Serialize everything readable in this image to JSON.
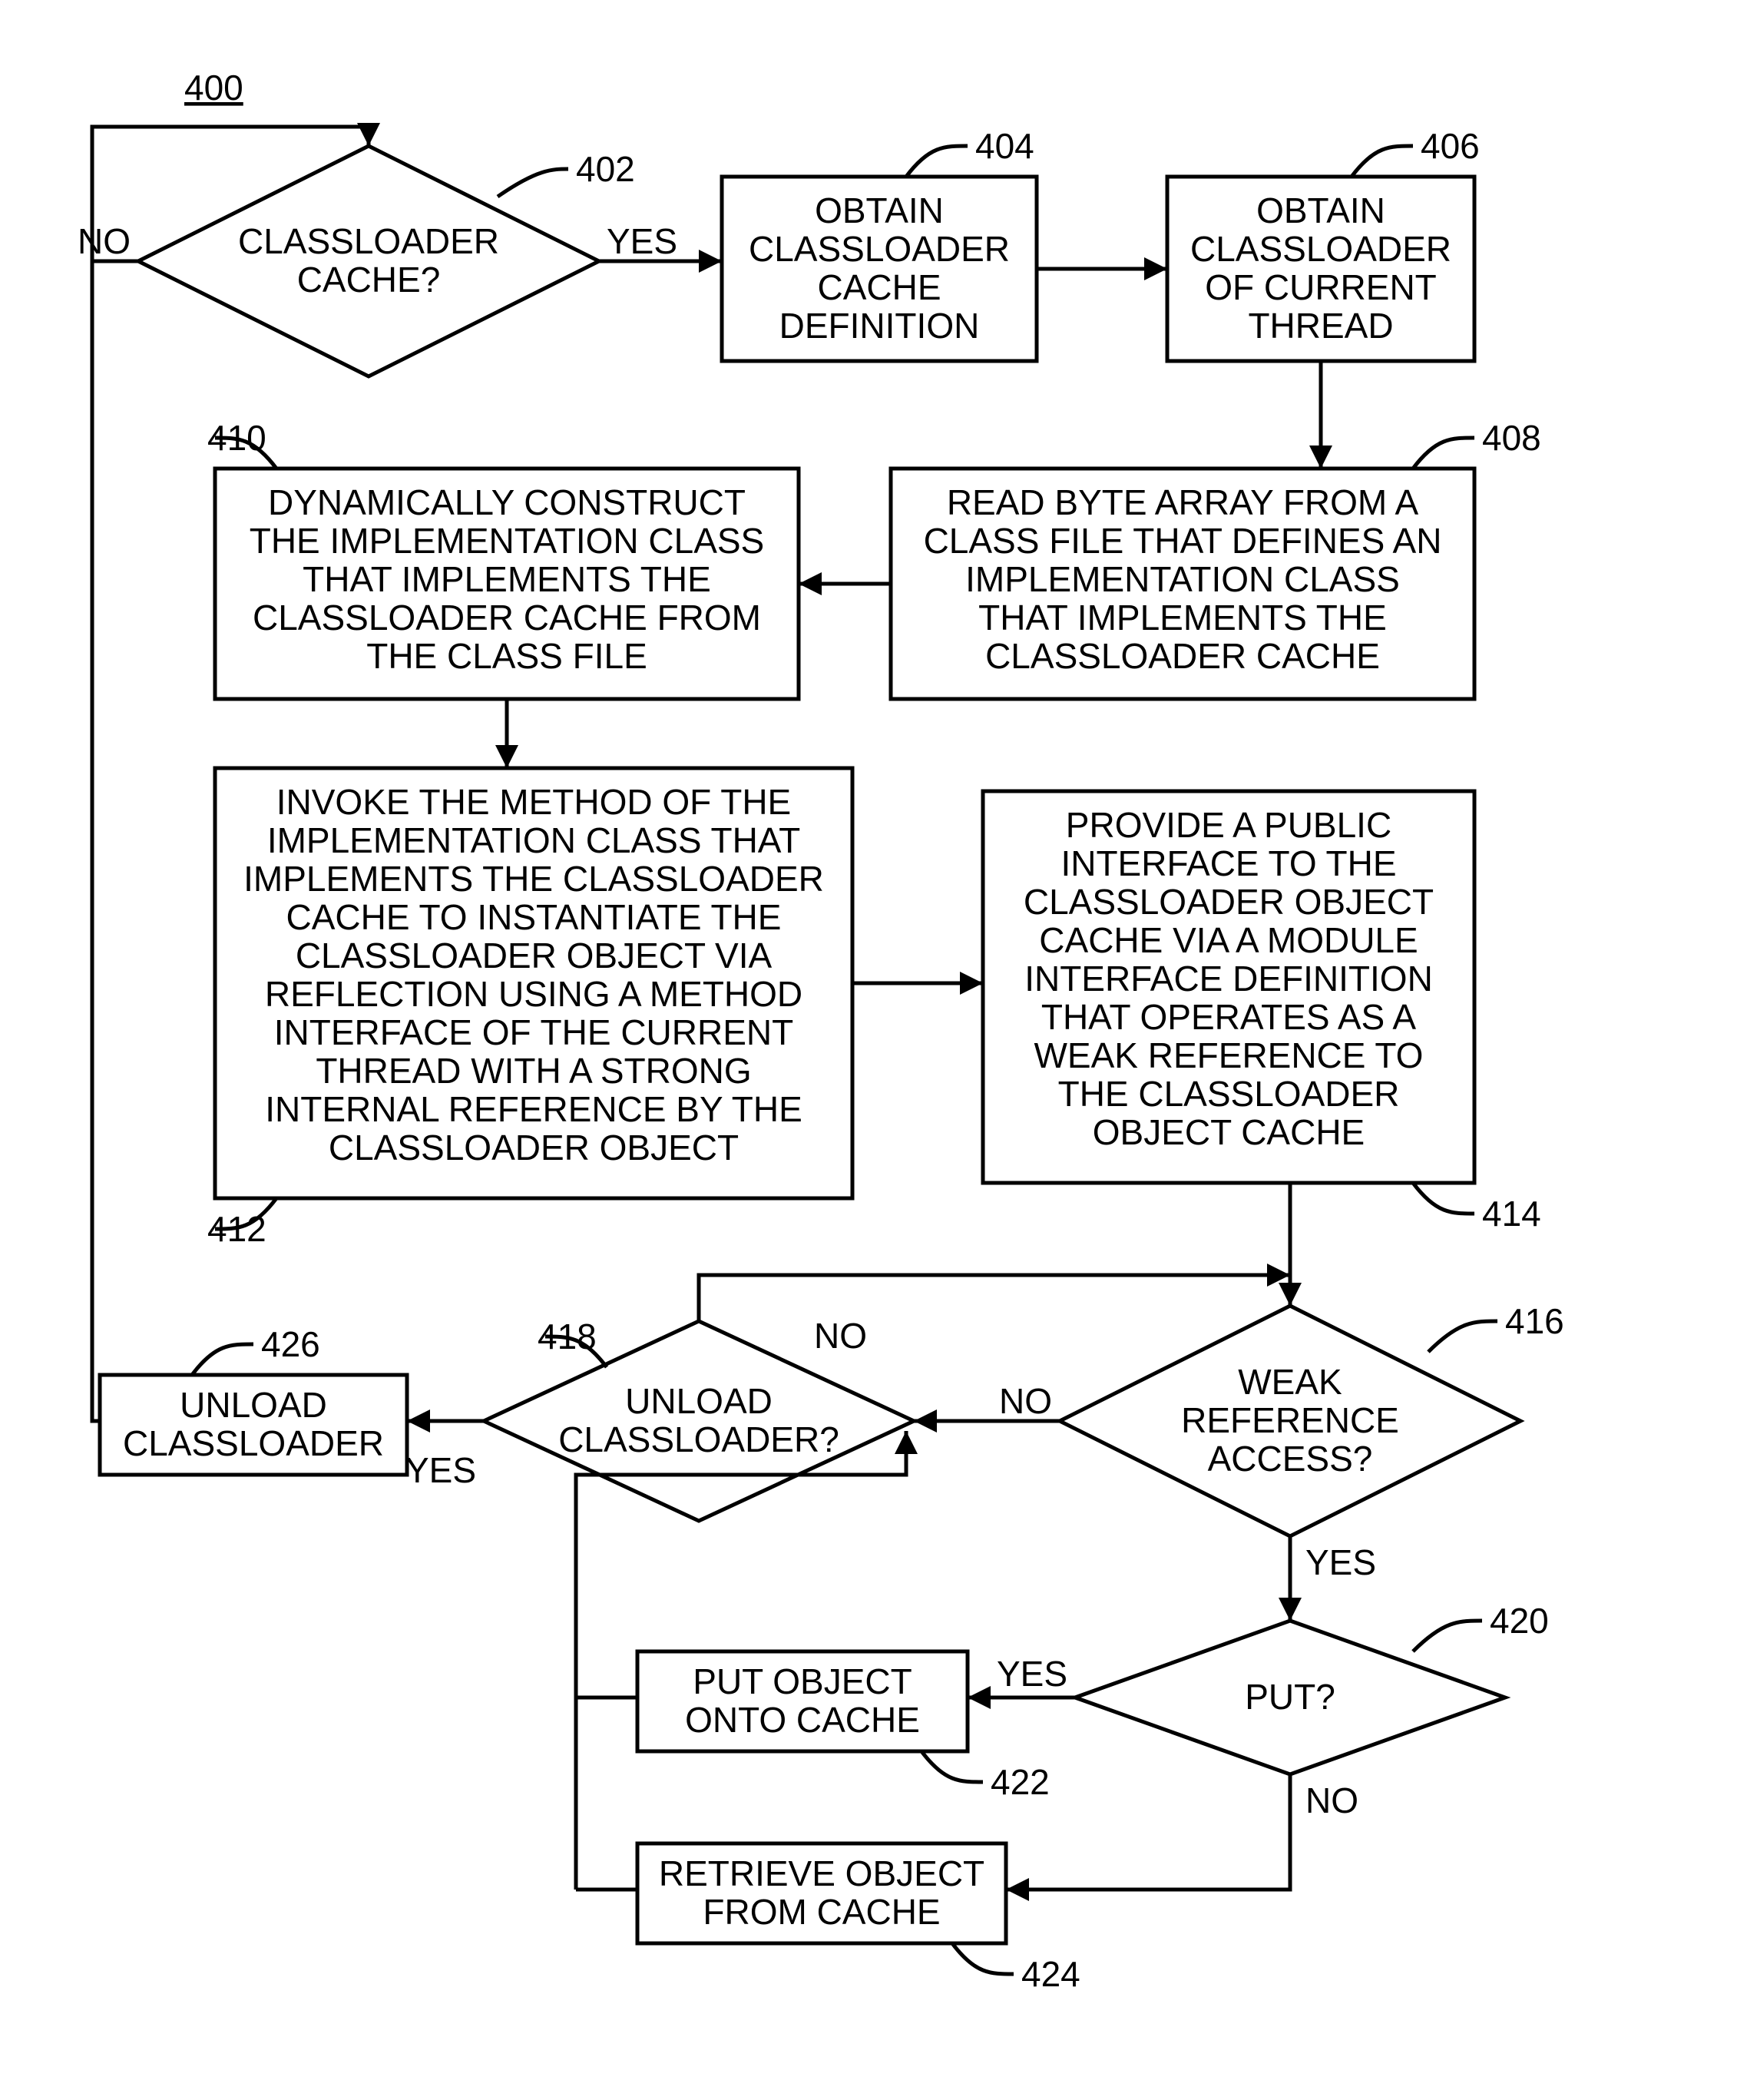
{
  "figureNumber": "400",
  "nodes": {
    "n402": {
      "ref": "402",
      "text": [
        "CLASSLOADER",
        "CACHE?"
      ],
      "yes": "YES",
      "no": "NO"
    },
    "n404": {
      "ref": "404",
      "text": [
        "OBTAIN",
        "CLASSLOADER",
        "CACHE",
        "DEFINITION"
      ]
    },
    "n406": {
      "ref": "406",
      "text": [
        "OBTAIN",
        "CLASSLOADER",
        "OF CURRENT",
        "THREAD"
      ]
    },
    "n408": {
      "ref": "408",
      "text": [
        "READ BYTE ARRAY FROM A",
        "CLASS FILE THAT DEFINES AN",
        "IMPLEMENTATION CLASS",
        "THAT IMPLEMENTS THE",
        "CLASSLOADER CACHE"
      ]
    },
    "n410": {
      "ref": "410",
      "text": [
        "DYNAMICALLY CONSTRUCT",
        "THE IMPLEMENTATION CLASS",
        "THAT IMPLEMENTS THE",
        "CLASSLOADER CACHE FROM",
        "THE CLASS FILE"
      ]
    },
    "n412": {
      "ref": "412",
      "text": [
        "INVOKE THE METHOD OF THE",
        "IMPLEMENTATION CLASS THAT",
        "IMPLEMENTS THE CLASSLOADER",
        "CACHE TO INSTANTIATE THE",
        "CLASSLOADER OBJECT VIA",
        "REFLECTION USING A METHOD",
        "INTERFACE OF THE CURRENT",
        "THREAD WITH A STRONG",
        "INTERNAL REFERENCE BY THE",
        "CLASSLOADER OBJECT"
      ]
    },
    "n414": {
      "ref": "414",
      "text": [
        "PROVIDE A PUBLIC",
        "INTERFACE TO THE",
        "CLASSLOADER OBJECT",
        "CACHE VIA A MODULE",
        "INTERFACE DEFINITION",
        "THAT OPERATES AS A",
        "WEAK REFERENCE TO",
        "THE CLASSLOADER",
        "OBJECT CACHE"
      ]
    },
    "n416": {
      "ref": "416",
      "text": [
        "WEAK",
        "REFERENCE",
        "ACCESS?"
      ],
      "yes": "YES",
      "no": "NO"
    },
    "n418": {
      "ref": "418",
      "text": [
        "UNLOAD",
        "CLASSLOADER?"
      ],
      "yes": "YES",
      "no": "NO"
    },
    "n420": {
      "ref": "420",
      "text": [
        "PUT?"
      ],
      "yes": "YES",
      "no": "NO"
    },
    "n422": {
      "ref": "422",
      "text": [
        "PUT OBJECT",
        "ONTO CACHE"
      ]
    },
    "n424": {
      "ref": "424",
      "text": [
        "RETRIEVE OBJECT",
        "FROM CACHE"
      ]
    },
    "n426": {
      "ref": "426",
      "text": [
        "UNLOAD",
        "CLASSLOADER"
      ]
    }
  }
}
